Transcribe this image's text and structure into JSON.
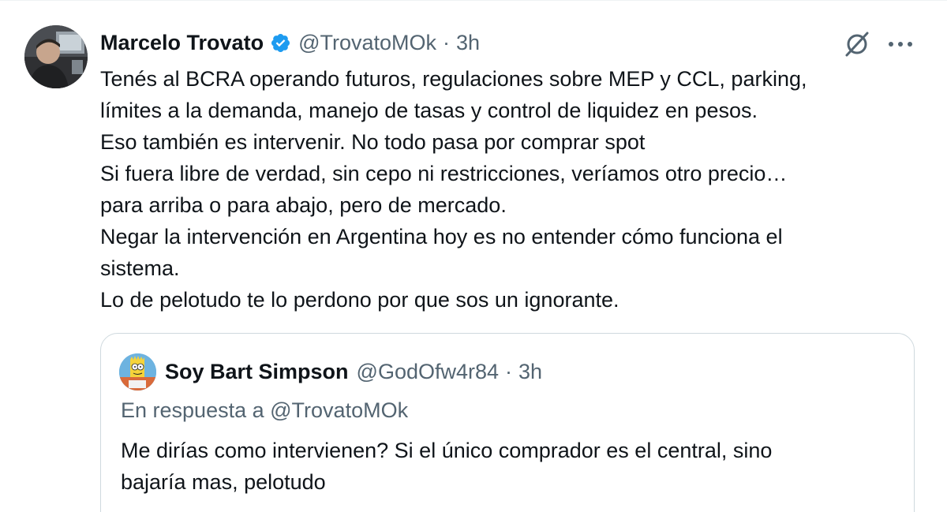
{
  "tweet": {
    "author_name": "Marcelo Trovato",
    "handle": "@TrovatoMOk",
    "separator": "·",
    "time": "3h",
    "verified_icon": "verified-badge-icon",
    "grok_icon": "grok-icon",
    "more_icon": "more-options-icon",
    "body_lines": [
      "Tenés al BCRA operando futuros, regulaciones sobre MEP y CCL, parking,",
      "límites a la demanda, manejo de tasas y control de liquidez en pesos.",
      "Eso también es intervenir. No todo pasa por comprar spot",
      "Si fuera libre de verdad, sin cepo ni restricciones, veríamos otro precio…",
      "para arriba o para abajo, pero de mercado.",
      "Negar la intervención en Argentina hoy es no entender cómo funciona el",
      "sistema.",
      "Lo de pelotudo te lo perdono por que sos un ignorante."
    ]
  },
  "quoted": {
    "author_name": "Soy Bart Simpson",
    "handle": "@GodOfw4r84",
    "separator": "·",
    "time": "3h",
    "reply_prefix": "En respuesta a",
    "reply_handle": "@TrovatoMOk",
    "body_lines": [
      "Me dirías como intervienen? Si el único comprador es el central, sino",
      "bajaría mas, pelotudo"
    ]
  },
  "colors": {
    "verified_blue": "#1d9bf0",
    "secondary_text": "#536471",
    "primary_text": "#0f1419",
    "border": "#cfd9de"
  }
}
